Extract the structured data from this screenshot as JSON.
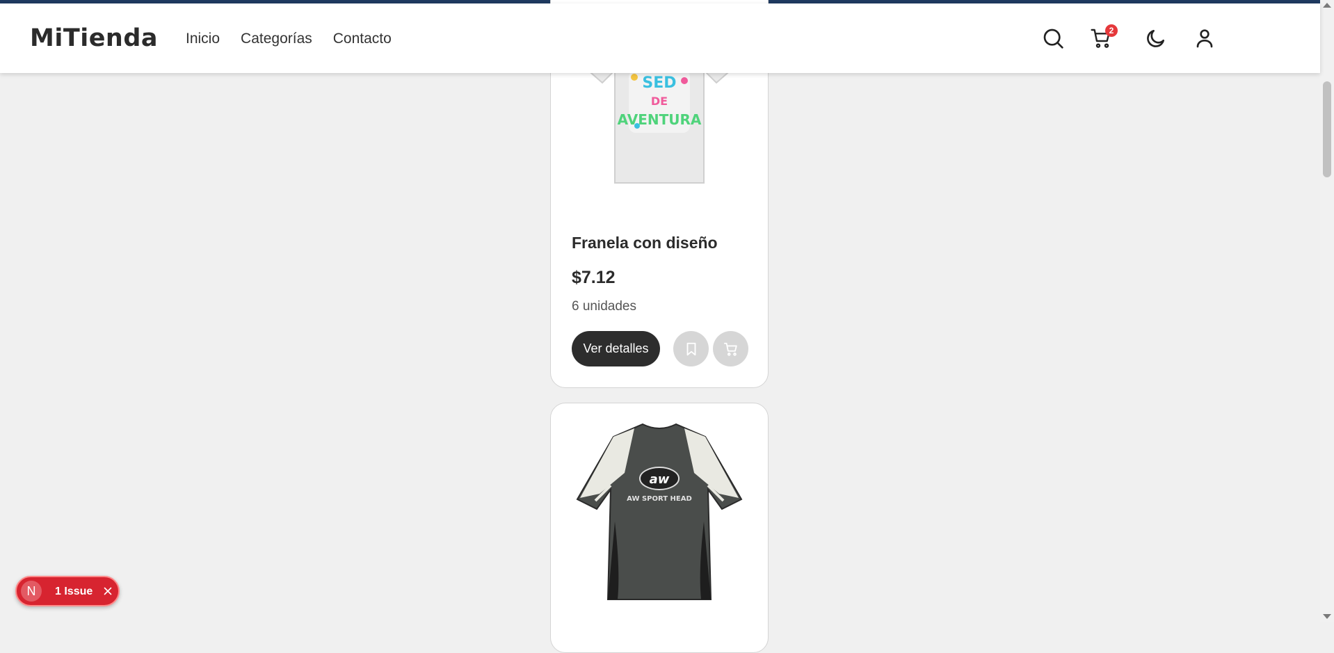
{
  "brand": {
    "logo": "MiTienda"
  },
  "nav": {
    "links": [
      {
        "label": "Inicio"
      },
      {
        "label": "Categorías"
      },
      {
        "label": "Contacto"
      }
    ]
  },
  "header_icons": {
    "search": "search-icon",
    "cart": "cart-icon",
    "cart_count": "2",
    "theme": "moon-icon",
    "account": "user-icon"
  },
  "products": [
    {
      "title": "Franela con diseño",
      "price": "$7.12",
      "stock": "6 unidades",
      "details_label": "Ver detalles",
      "image": "white-t-shirt-graphic",
      "image_text": "SED DE AVENTURA"
    },
    {
      "image": "dark-grey-sport-t-shirt",
      "image_text": "AW SPORT HEAD"
    }
  ],
  "issues_badge": {
    "logo": "N",
    "text": "1 Issue"
  },
  "colors": {
    "accent_bar": "#1f3a60",
    "badge_red": "#e5383b",
    "button_dark": "#2d2d2d",
    "issue_red": "#d72430"
  }
}
